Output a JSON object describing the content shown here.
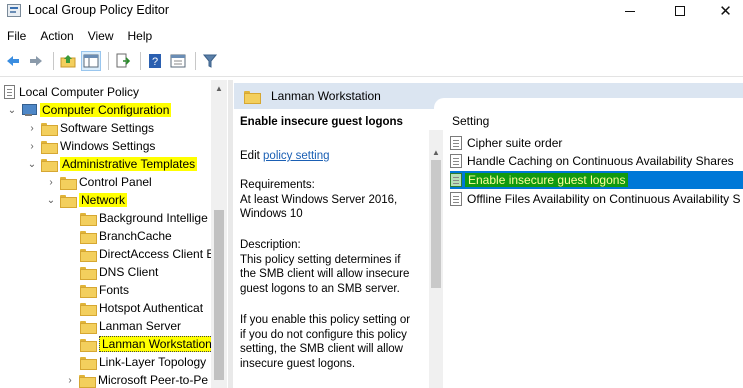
{
  "window": {
    "title": "Local Group Policy Editor",
    "minimize": "—",
    "maximize": "☐",
    "close": "✕"
  },
  "menu": [
    "File",
    "Action",
    "View",
    "Help"
  ],
  "toolbar": {
    "buttons": [
      "back-icon",
      "forward-icon",
      "up-folder-icon",
      "show-hide-tree-icon",
      "export-list-icon",
      "help-icon",
      "properties-icon",
      "filter-icon"
    ]
  },
  "tree": {
    "root": "Local Computer Policy",
    "items": [
      {
        "label": "Computer Configuration",
        "highlight": true
      },
      {
        "label": "Software Settings"
      },
      {
        "label": "Windows Settings"
      },
      {
        "label": "Administrative Templates",
        "highlight": true
      },
      {
        "label": "Control Panel"
      },
      {
        "label": "Network",
        "highlight": true
      },
      {
        "label": "Background Intellige"
      },
      {
        "label": "BranchCache"
      },
      {
        "label": "DirectAccess Client E"
      },
      {
        "label": "DNS Client"
      },
      {
        "label": "Fonts"
      },
      {
        "label": "Hotspot Authenticat"
      },
      {
        "label": "Lanman Server"
      },
      {
        "label": "Lanman Workstation",
        "highlight": true,
        "selected": true
      },
      {
        "label": "Link-Layer Topology"
      },
      {
        "label": "Microsoft Peer-to-Pe"
      }
    ]
  },
  "right_header": "Lanman Workstation",
  "description": {
    "title": "Enable insecure guest logons",
    "edit_prefix": "Edit",
    "edit_link": "policy setting",
    "requirements_label": "Requirements:",
    "requirements_lines": [
      "At least Windows Server 2016,",
      "Windows 10"
    ],
    "description_label": "Description:",
    "description_lines": [
      "This policy setting determines if",
      "the SMB client will allow insecure",
      "guest logons to an SMB server."
    ],
    "enable_lines": [
      "If you enable this policy setting or",
      "if you do not configure this policy",
      "setting, the SMB client will allow",
      "insecure guest logons."
    ]
  },
  "settings_list": {
    "column_header": "Setting",
    "items": [
      {
        "label": "Cipher suite order"
      },
      {
        "label": "Handle Caching on Continuous Availability Shares"
      },
      {
        "label": "Enable insecure guest logons",
        "selected": true
      },
      {
        "label": "Offline Files Availability on Continuous Availability S"
      }
    ]
  },
  "colors": {
    "highlight": "#ffff00",
    "selection": "#0078d7",
    "selection_highlight": "#109a10",
    "header_band": "#dbe5f1"
  }
}
